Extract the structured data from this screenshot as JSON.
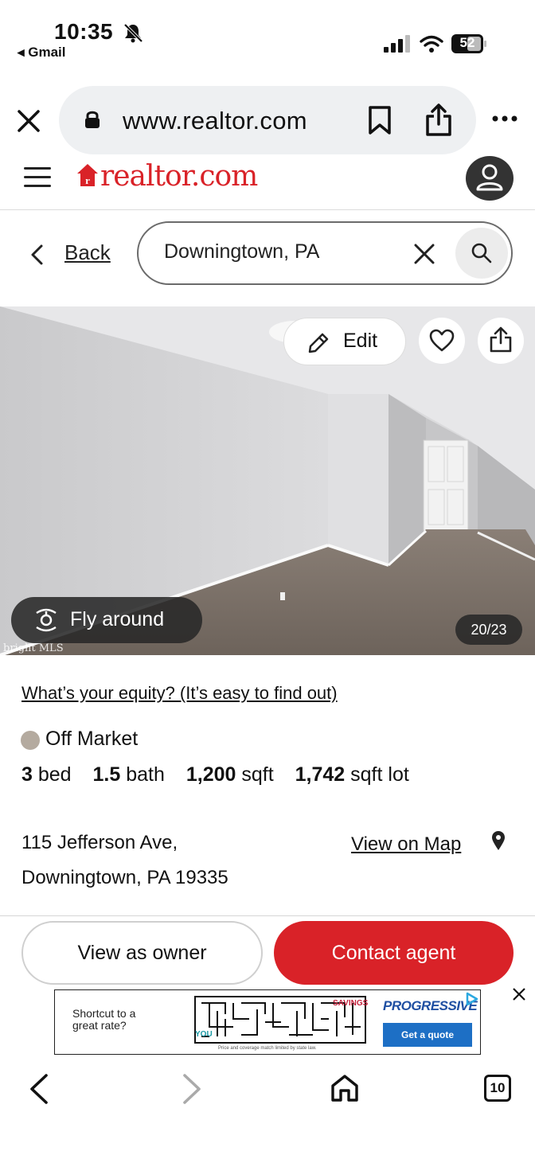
{
  "status_bar": {
    "time": "10:35",
    "back_app": "◂ Gmail",
    "battery": "52"
  },
  "browser": {
    "url": "www.realtor.com",
    "tab_count": "10"
  },
  "site": {
    "logo": "realtor.com",
    "logo_color": "#d92228"
  },
  "search": {
    "back_label": "Back",
    "value": "Downingtown, PA"
  },
  "photo": {
    "edit_label": "Edit",
    "fly_label": "Fly around",
    "counter": "20/23",
    "watermark": "bright MLS"
  },
  "listing": {
    "equity_link": "What’s your equity? (It’s easy to find out)",
    "status": "Off Market",
    "status_color": "#b4aa9f",
    "specs": [
      {
        "value": "3",
        "unit": "bed"
      },
      {
        "value": "1.5",
        "unit": "bath"
      },
      {
        "value": "1,200",
        "unit": "sqft"
      },
      {
        "value": "1,742",
        "unit": "sqft lot"
      }
    ],
    "address_line1": "115 Jefferson Ave,",
    "address_line2": "Downingtown, PA 19335",
    "map_link": "View on Map"
  },
  "actions": {
    "owner_label": "View as owner",
    "contact_label": "Contact agent",
    "accent": "#d92228"
  },
  "ad": {
    "headline": "Shortcut to a great rate?",
    "you": "YOU",
    "savings": "SAVINGS",
    "brand": "PROGRESSIVE",
    "cta": "Get a quote",
    "fine_print": "Price and coverage match limited by state law."
  }
}
